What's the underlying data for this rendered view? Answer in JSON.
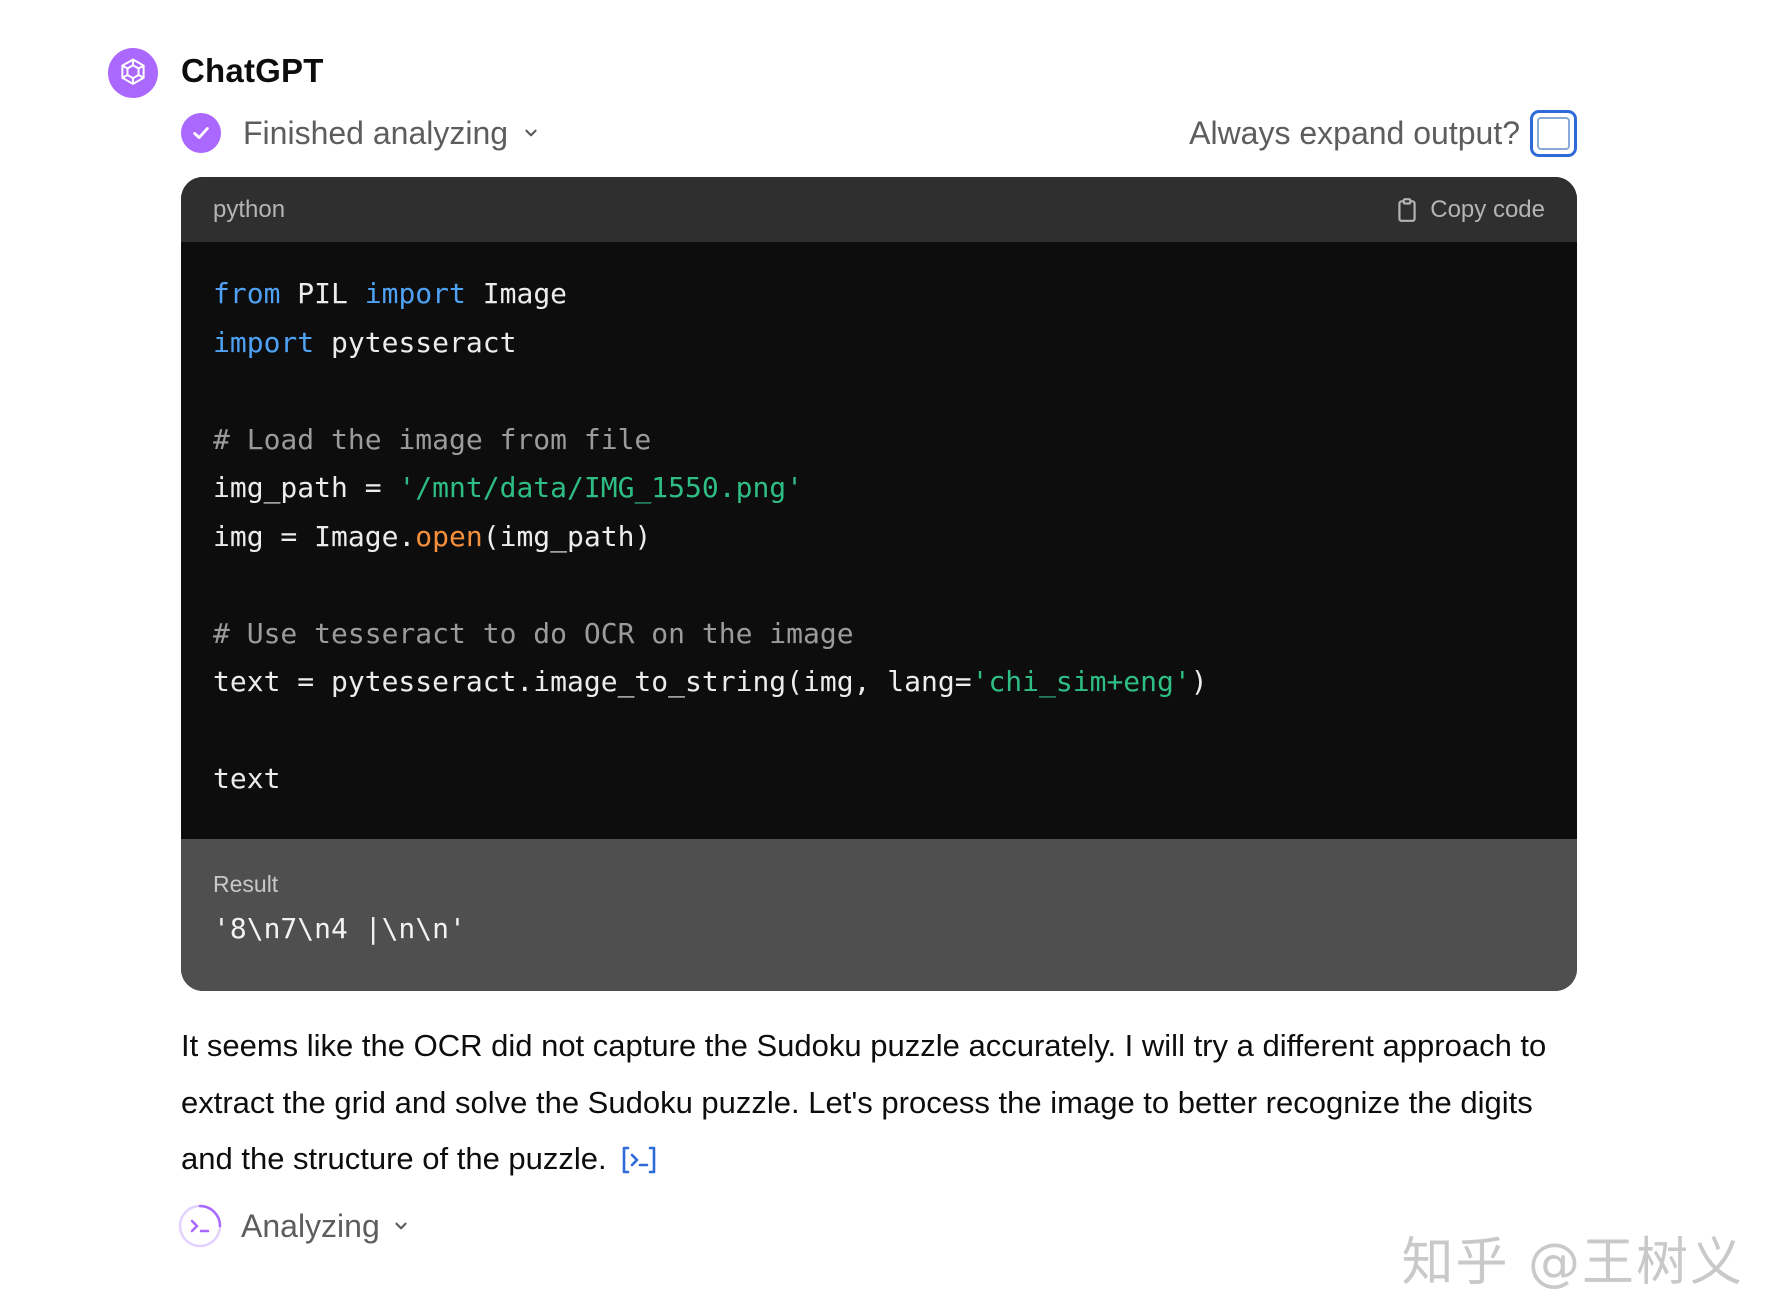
{
  "header": {
    "author": "ChatGPT",
    "avatar_icon": "openai-logo-icon",
    "avatar_color": "#ab68ff"
  },
  "status": {
    "label": "Finished analyzing",
    "expand_label": "Always expand output?",
    "expand_checked": false
  },
  "code_block": {
    "language": "python",
    "copy_label": "Copy code",
    "lines": [
      [
        {
          "t": "from",
          "c": "kw"
        },
        {
          "t": " PIL ",
          "c": ""
        },
        {
          "t": "import",
          "c": "kw"
        },
        {
          "t": " Image",
          "c": ""
        }
      ],
      [
        {
          "t": "import",
          "c": "kw"
        },
        {
          "t": " pytesseract",
          "c": ""
        }
      ],
      [],
      [
        {
          "t": "# Load the image from file",
          "c": "cm"
        }
      ],
      [
        {
          "t": "img_path = ",
          "c": ""
        },
        {
          "t": "'/mnt/data/IMG_1550.png'",
          "c": "str"
        }
      ],
      [
        {
          "t": "img = Image.",
          "c": ""
        },
        {
          "t": "open",
          "c": "fn"
        },
        {
          "t": "(img_path)",
          "c": ""
        }
      ],
      [],
      [
        {
          "t": "# Use tesseract to do OCR on the image",
          "c": "cm"
        }
      ],
      [
        {
          "t": "text = pytesseract.image_to_string(img, lang=",
          "c": ""
        },
        {
          "t": "'chi_sim+eng'",
          "c": "str"
        },
        {
          "t": ")",
          "c": ""
        }
      ],
      [],
      [
        {
          "t": "text",
          "c": ""
        }
      ]
    ],
    "result_label": "Result",
    "result_value": "'8\\n7\\n4 |\\n\\n'"
  },
  "message": {
    "paragraph": "It seems like the OCR did not capture the Sudoku puzzle accurately. I will try a different approach to extract the grid and solve the Sudoku puzzle. Let's process the image to better recognize the digits and the structure of the puzzle."
  },
  "analyzing": {
    "label": "Analyzing"
  },
  "watermark": "知乎 @王树义"
}
